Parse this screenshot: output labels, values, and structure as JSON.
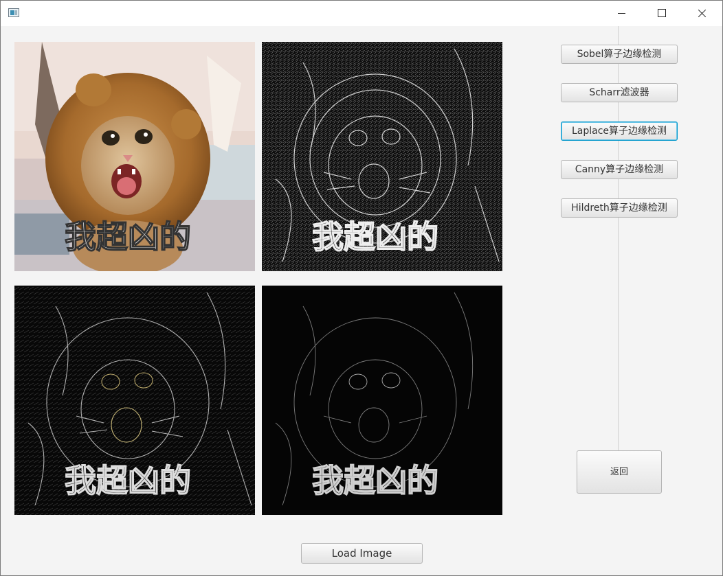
{
  "window": {
    "title": ""
  },
  "images": [
    {
      "caption": "我超凶的",
      "variant": "original"
    },
    {
      "caption": "我超凶的",
      "variant": "sobel-edges"
    },
    {
      "caption": "我超凶的",
      "variant": "scharr-edges"
    },
    {
      "caption": "我超凶的",
      "variant": "laplace-edges"
    }
  ],
  "sidebar": {
    "buttons": [
      {
        "label": "Sobel算子边缘检测"
      },
      {
        "label": "Scharr滤波器"
      },
      {
        "label": "Laplace算子边缘检测",
        "focused": true
      },
      {
        "label": "Canny算子边缘检测"
      },
      {
        "label": "Hildreth算子边缘检测"
      }
    ],
    "back_label": "返回"
  },
  "footer": {
    "load_label": "Load Image"
  },
  "colors": {
    "focus_border": "#0096c9",
    "window_bg": "#f4f4f4"
  }
}
